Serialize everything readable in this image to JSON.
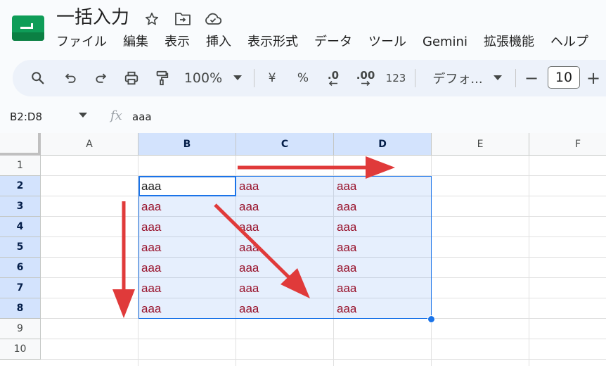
{
  "window": {
    "title": "一括入力"
  },
  "menu": {
    "items": [
      "ファイル",
      "編集",
      "表示",
      "挿入",
      "表示形式",
      "データ",
      "ツール",
      "Gemini",
      "拡張機能",
      "ヘルプ"
    ]
  },
  "toolbar": {
    "zoom": "100%",
    "currency_symbol": "¥",
    "percent_symbol": "%",
    "decrease_decimal": ".0",
    "increase_decimal": ".00",
    "number_format": "123",
    "font_name": "デフォ...",
    "font_size_minus": "−",
    "font_size": "10",
    "font_size_plus": "+"
  },
  "formula_bar": {
    "name_box": "B2:D8",
    "fx": "fx",
    "value": "aaa"
  },
  "grid": {
    "columns": [
      "A",
      "B",
      "C",
      "D",
      "E",
      "F"
    ],
    "selected_columns": [
      "B",
      "C",
      "D"
    ],
    "rows": [
      "1",
      "2",
      "3",
      "4",
      "5",
      "6",
      "7",
      "8",
      "9",
      "10"
    ],
    "selected_rows": [
      "2",
      "3",
      "4",
      "5",
      "6",
      "7",
      "8"
    ],
    "cells": {
      "B2": "aaa",
      "C2": "aaa",
      "D2": "aaa",
      "B3": "aaa",
      "C3": "aaa",
      "D3": "aaa",
      "B4": "aaa",
      "C4": "aaa",
      "D4": "aaa",
      "B5": "aaa",
      "C5": "aaa",
      "D5": "aaa",
      "B6": "aaa",
      "C6": "aaa",
      "D6": "aaa",
      "B7": "aaa",
      "C7": "aaa",
      "D7": "aaa",
      "B8": "aaa",
      "C8": "aaa",
      "D8": "aaa"
    },
    "active_cell": "B2",
    "selection": "B2:D8"
  },
  "colors": {
    "brand_green": "#188038",
    "selection_blue": "#1a73e8",
    "cell_text": "#98122b",
    "annotation_arrow": "#e03a3a"
  },
  "icons": [
    "sheets-logo-icon",
    "star-icon",
    "move-folder-icon",
    "cloud-status-icon",
    "search-icon",
    "undo-icon",
    "redo-icon",
    "print-icon",
    "paint-format-icon",
    "dropdown-icon"
  ]
}
